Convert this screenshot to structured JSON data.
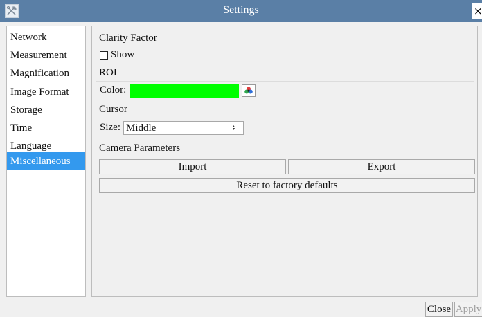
{
  "window": {
    "title": "Settings",
    "close_glyph": "×"
  },
  "nav": {
    "items": [
      {
        "label": "Network"
      },
      {
        "label": "Measurement"
      },
      {
        "label": "Magnification"
      },
      {
        "label": "Image Format"
      },
      {
        "label": "Storage"
      },
      {
        "label": "Time"
      },
      {
        "label": "Language"
      },
      {
        "label": "Miscellaneous"
      }
    ],
    "selected": "Miscellaneous"
  },
  "clarity": {
    "title": "Clarity Factor",
    "show_label": "Show",
    "show_checked": false
  },
  "roi": {
    "title": "ROI",
    "color_label": "Color:",
    "color_value": "#00ff00"
  },
  "cursor": {
    "title": "Cursor",
    "size_label": "Size:",
    "size_value": "Middle"
  },
  "camera": {
    "title": "Camera Parameters",
    "import_label": "Import",
    "export_label": "Export",
    "reset_label": "Reset to factory defaults"
  },
  "footer": {
    "close_label": "Close",
    "apply_label": "Apply"
  },
  "icons": {
    "window": "tools-icon",
    "color_picker": "color-palette-icon",
    "dropdown": "updown-arrows-icon"
  },
  "colors": {
    "titlebar": "#5a7fa6",
    "selected_nav": "#3399ee",
    "roi_color": "#00ff00"
  }
}
